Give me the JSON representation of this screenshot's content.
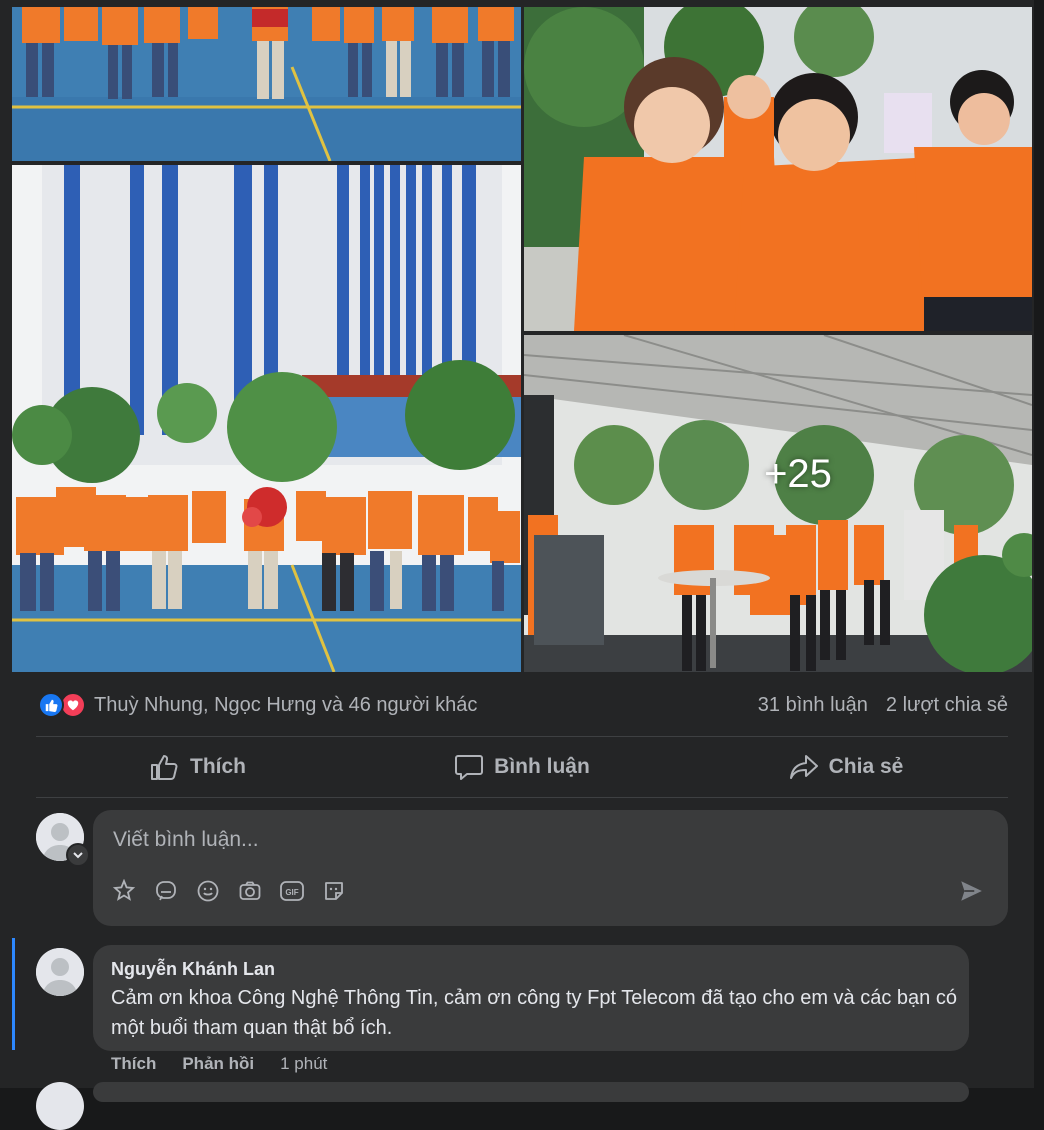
{
  "post": {
    "photos": [
      {
        "name": "students-group-photo-top"
      },
      {
        "name": "students-group-photo-building"
      },
      {
        "name": "students-checking-phones"
      },
      {
        "name": "students-queue-under-canopy",
        "more_label": "+25"
      }
    ],
    "reactions": {
      "icons": [
        "like-icon",
        "love-icon"
      ],
      "names": "Thuỳ Nhung, Ngọc Hưng và 46 người khác",
      "comments": "31 bình luận",
      "shares": "2 lượt chia sẻ"
    },
    "actions": {
      "like": "Thích",
      "comment": "Bình luận",
      "share": "Chia sẻ"
    }
  },
  "composer": {
    "placeholder": "Viết bình luận...",
    "tools": [
      "sticker-icon",
      "avatar-sticker-icon",
      "emoji-icon",
      "camera-icon",
      "gif-icon",
      "sticker-face-icon"
    ]
  },
  "comments": [
    {
      "author": "Nguyễn Khánh Lan",
      "text": "Cảm ơn khoa Công Nghệ Thông Tin, cảm ơn công ty Fpt Telecom đã tạo cho em và các bạn có một buổi tham quan thật bổ ích.",
      "like_label": "Thích",
      "reply_label": "Phản hồi",
      "time": "1 phút"
    }
  ],
  "colors": {
    "background": "#18191a",
    "card": "#242526",
    "bubble": "#3a3b3c",
    "text": "#e4e6eb",
    "secondary": "#b0b3b8",
    "accent": "#2d88ff",
    "shirt": "#f26f21"
  }
}
